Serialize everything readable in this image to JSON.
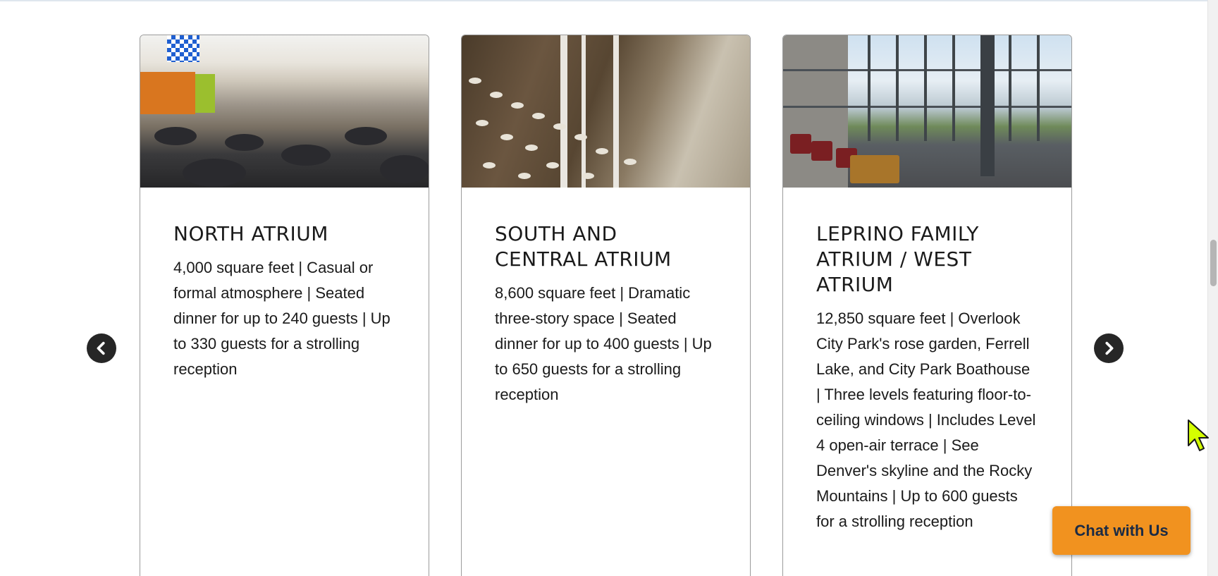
{
  "cards": [
    {
      "title": "NORTH ATRIUM",
      "description": "4,000 square feet | Casual or formal atmosphere | Seated dinner for up to 240 guests | Up to 330 guests for a strolling reception"
    },
    {
      "title": "SOUTH AND CENTRAL ATRIUM",
      "description": "8,600 square feet | Dramatic three-story space | Seated dinner for up to 400 guests | Up to 650 guests for a strolling reception"
    },
    {
      "title": "LEPRINO FAMILY ATRIUM / WEST ATRIUM",
      "description": "12,850 square feet | Overlook City Park's rose garden, Ferrell Lake, and City Park Boathouse | Three levels featuring floor-to-ceiling windows | Includes Level 4 open-air terrace | See Denver's skyline and the Rocky Mountains | Up to 600 guests for a strolling reception"
    }
  ],
  "carousel": {
    "prev_icon": "chevron-left-icon",
    "next_icon": "chevron-right-icon"
  },
  "chat": {
    "label": "Chat with Us",
    "color": "#f1921f"
  },
  "cursor": {
    "icon": "pointer-arrow-icon",
    "color": "#d4ff00"
  }
}
